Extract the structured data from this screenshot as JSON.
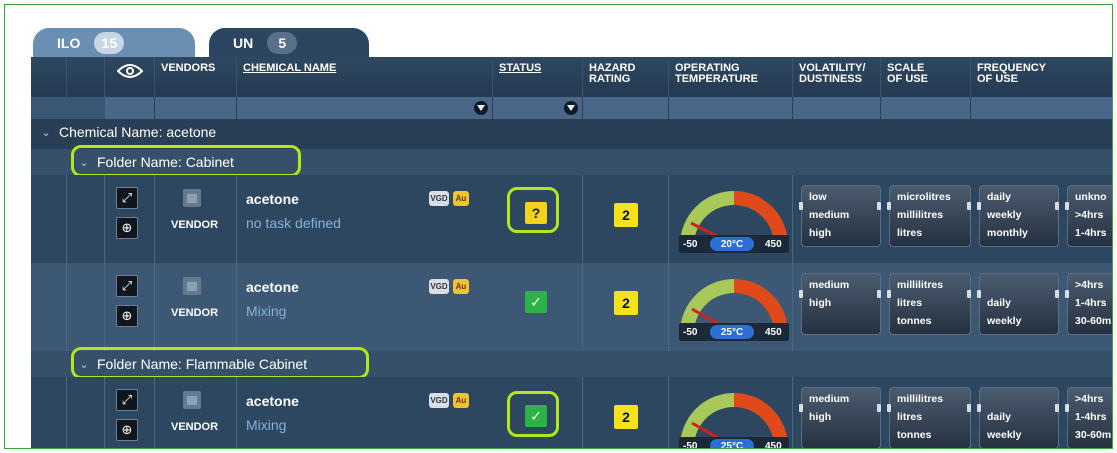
{
  "tabs": [
    {
      "label": "ILO",
      "count": "15"
    },
    {
      "label": "UN",
      "count": "5"
    }
  ],
  "columns": {
    "vendors": "VENDORS",
    "chemical_name": "CHEMICAL NAME",
    "status": "STATUS",
    "hazard_l1": "HAZARD",
    "hazard_l2": "RATING",
    "optemp_l1": "OPERATING",
    "optemp_l2": "TEMPERATURE",
    "volatility_l1": "VOLATILITY/",
    "volatility_l2": "DUSTINESS",
    "scale_l1": "SCALE",
    "scale_l2": "OF USE",
    "frequency_l1": "FREQUENCY",
    "frequency_l2": "OF USE"
  },
  "groups": {
    "chemical": "Chemical Name: acetone",
    "folder1": "Folder Name: Cabinet",
    "folder2": "Folder Name: Flammable Cabinet"
  },
  "rows": [
    {
      "vendor_label": "VENDOR",
      "chemical": "acetone",
      "task": "no task defined",
      "badge_vgd": "VGD",
      "badge_au": "Au",
      "status": "?",
      "hazard": "2",
      "gauge": {
        "min": "-50",
        "max": "450",
        "temp": "20°C",
        "value": 20
      },
      "volatility": [
        "low",
        "medium",
        "high"
      ],
      "scale": [
        "microlitres",
        "millilitres",
        "litres"
      ],
      "frequency": [
        "daily",
        "weekly",
        "monthly"
      ],
      "duration": [
        "unkno",
        ">4hrs",
        "1-4hrs"
      ]
    },
    {
      "vendor_label": "VENDOR",
      "chemical": "acetone",
      "task": "Mixing",
      "badge_vgd": "VGD",
      "badge_au": "Au",
      "status": "✓",
      "hazard": "2",
      "gauge": {
        "min": "-50",
        "max": "450",
        "temp": "25°C",
        "value": 25
      },
      "volatility": [
        "medium",
        "high"
      ],
      "scale": [
        "millilitres",
        "litres",
        "tonnes"
      ],
      "frequency": [
        "daily",
        "weekly"
      ],
      "duration": [
        ">4hrs",
        "1-4hrs",
        "30-60m"
      ]
    },
    {
      "vendor_label": "VENDOR",
      "chemical": "acetone",
      "task": "Mixing",
      "badge_vgd": "VGD",
      "badge_au": "Au",
      "status": "✓",
      "hazard": "2",
      "gauge": {
        "min": "-50",
        "max": "450",
        "temp": "25°C",
        "value": 25
      },
      "volatility": [
        "medium",
        "high"
      ],
      "scale": [
        "millilitres",
        "litres",
        "tonnes"
      ],
      "frequency": [
        "daily",
        "weekly"
      ],
      "duration": [
        ">4hrs",
        "1-4hrs",
        "30-60m"
      ]
    }
  ],
  "colors": {
    "tab_active": "#6a8fb3",
    "tab_inactive": "#2c4560",
    "highlight": "#b4e61e",
    "status_ok": "#2db24a",
    "status_unknown": "#f2d21a",
    "hazard": "#f5e21c",
    "temp_badge": "#2a6ed6"
  },
  "icons": {
    "visibility": "eye-icon",
    "filter": "funnel-icon",
    "expand": "expand-arrows-icon",
    "target": "crosshair-icon",
    "vendor": "factory-icon",
    "collapse": "chevron-down-icon"
  }
}
